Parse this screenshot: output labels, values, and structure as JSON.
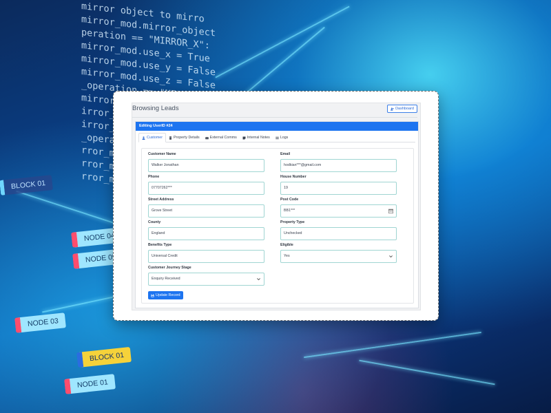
{
  "background": {
    "code_lines": [
      "mirror object to mirro",
      "mirror_mod.mirror_object",
      "",
      "peration == \"MIRROR_X\":",
      "mirror_mod.use_x = True",
      "mirror_mod.use_y = False",
      "mirror_mod.use_z = False",
      "_operation == \"MIRROR_Y\"",
      "mirror_mod.use_x = False",
      "irror_mod.use_y = True",
      "irror_mod.use_z = False",
      "_operation == \"MIRROR_Z\"",
      "rror_mod.use_x = False",
      "rror_mod.use_y = False",
      "rror_mod.use_z = True"
    ],
    "tags": {
      "block_01_top": "BLOCK 01",
      "node_04": "NODE 04",
      "node_05": "NODE 05",
      "node_03": "NODE 03",
      "block_01_bottom": "BLOCK 01",
      "node_01": "NODE 01"
    }
  },
  "header": {
    "title": "Browsing Leads",
    "dashboard_label": "Dashboard"
  },
  "panel": {
    "heading": "Editing UserID #24",
    "tabs": [
      {
        "label": "Customer",
        "icon": "user-icon",
        "active": true
      },
      {
        "label": "Property Details",
        "icon": "building-icon",
        "active": false
      },
      {
        "label": "External Comms",
        "icon": "envelope-icon",
        "active": false
      },
      {
        "label": "Internal Notes",
        "icon": "note-icon",
        "active": false
      },
      {
        "label": "Logs",
        "icon": "list-icon",
        "active": false
      }
    ]
  },
  "form": {
    "customer_name": {
      "label": "Customer Name",
      "value": "Walker Jonathan"
    },
    "email": {
      "label": "Email",
      "value": "hodkian***@gmail.com"
    },
    "phone": {
      "label": "Phone",
      "value": "07707262***"
    },
    "house_number": {
      "label": "House Number",
      "value": "19"
    },
    "street_address": {
      "label": "Street Address",
      "value": "Grove Street"
    },
    "post_code": {
      "label": "Post Code",
      "value": "BB1***"
    },
    "county": {
      "label": "County",
      "value": "England"
    },
    "property_type": {
      "label": "Property Type",
      "value": "Unchecked"
    },
    "benefits_type": {
      "label": "Benefits Type",
      "value": "Universal Credit"
    },
    "eligible": {
      "label": "Eligible",
      "value": "Yes"
    },
    "journey_stage": {
      "label": "Customer Journey Stage",
      "value": "Enquiry Received"
    },
    "submit_label": "Update Record"
  },
  "colors": {
    "primary": "#1d74f0",
    "input_border": "#9fd5d2"
  }
}
